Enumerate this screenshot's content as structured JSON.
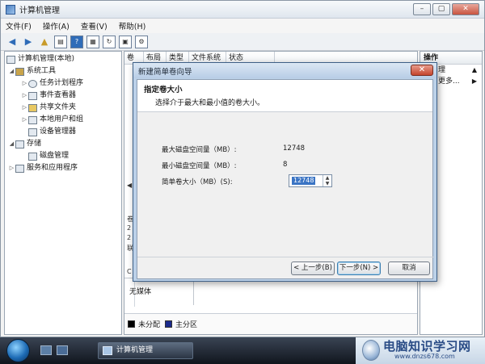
{
  "window": {
    "title": "计算机管理"
  },
  "menu": [
    "文件(F)",
    "操作(A)",
    "查看(V)",
    "帮助(H)"
  ],
  "tree": {
    "root": "计算机管理(本地)",
    "items": [
      {
        "label": "系统工具",
        "level": 1,
        "expanded": true
      },
      {
        "label": "任务计划程序",
        "level": 2
      },
      {
        "label": "事件查看器",
        "level": 2
      },
      {
        "label": "共享文件夹",
        "level": 2
      },
      {
        "label": "本地用户和组",
        "level": 2
      },
      {
        "label": "设备管理器",
        "level": 2
      },
      {
        "label": "存储",
        "level": 1,
        "expanded": true
      },
      {
        "label": "磁盘管理",
        "level": 2
      },
      {
        "label": "服务和应用程序",
        "level": 1
      }
    ]
  },
  "columns": [
    "卷",
    "布局",
    "类型",
    "文件系统",
    "状态"
  ],
  "left_strip": [
    "卷",
    "2",
    "2",
    "联",
    "C"
  ],
  "no_media": "无媒体",
  "legend": {
    "unallocated": "未分配",
    "primary": "主分区",
    "unallocated_color": "#000000",
    "primary_color": "#1b2a8c"
  },
  "actions": {
    "header": "操作",
    "items": [
      {
        "label": "理",
        "arrow": "▲"
      },
      {
        "label": "更多...",
        "arrow": "▶"
      }
    ]
  },
  "dialog": {
    "title": "新建简单卷向导",
    "heading": "指定卷大小",
    "subheading": "选择介于最大和最小值的卷大小。",
    "max_label": "最大磁盘空间量（MB）:",
    "max_value": "12748",
    "min_label": "最小磁盘空间量（MB）:",
    "min_value": "8",
    "size_label": "简单卷大小（MB）(S):",
    "size_value": "12748",
    "back": "< 上一步(B)",
    "next": "下一步(N) >",
    "cancel": "取消"
  },
  "taskbar": {
    "task_label": "计算机管理"
  },
  "watermark": {
    "text": "电脑知识学习网",
    "url": "www.dnzs678.com"
  }
}
